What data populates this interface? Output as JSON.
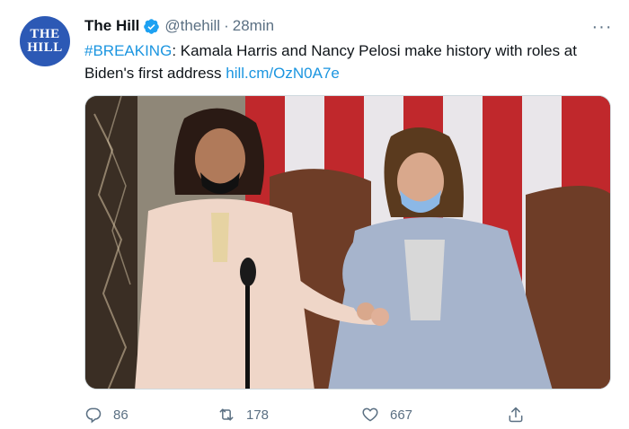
{
  "tweet": {
    "avatar_line1": "THE",
    "avatar_line2": "HILL",
    "name": "The Hill",
    "handle": "@thehill",
    "separator": "·",
    "time": "28min",
    "more_icon": "more-horizontal-icon",
    "hashtag": "#BREAKING",
    "body_text": ": Kamala Harris and Nancy Pelosi make history with roles at Biden's first address ",
    "link": "hill.cm/OzN0A7e",
    "media_icon": "photo",
    "reply_count": "86",
    "retweet_count": "178",
    "like_count": "667"
  },
  "colors": {
    "link": "#1b95e0",
    "secondary_text": "#5b7083",
    "avatar_bg": "#2c59b5",
    "verified": "#1da1f2"
  }
}
